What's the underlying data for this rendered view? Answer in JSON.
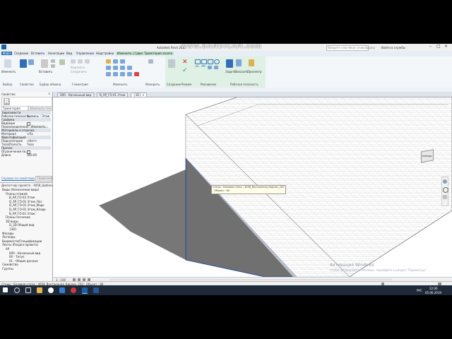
{
  "app": {
    "title": "Autodesk Revit 2019",
    "recorder_watermark": "www.BANDICAM.com",
    "search_placeholder": "Введите ключевое слово/фразу",
    "signin": "Войти в службы"
  },
  "menu": {
    "tabs": [
      "Файл",
      "Создание",
      "Вставить",
      "Аннотации",
      "Вид",
      "Управление",
      "Надстройки",
      "Изменить | Сдвиг",
      "Траектория эскиза"
    ]
  },
  "ribbon": {
    "panels": [
      "Выбор",
      "Свойства",
      "Буфер обмена",
      "Геометрия",
      "Изменить",
      "Измерить",
      "Создание",
      "Режим",
      "Рисование",
      "Рабочая плоскость"
    ],
    "buttons": {
      "modify": "Изменить",
      "paste": "Вставить",
      "set": "Задать",
      "show": "Показать",
      "viewer": "Просмотр"
    }
  },
  "properties": {
    "header": "Свойства",
    "type_selector": "Траектория",
    "edit_type": "Изменить тип",
    "rows": [
      {
        "label": "Зависимости",
        "value": "",
        "section": true
      },
      {
        "label": "Рабочая плоскость",
        "value": "Уровень : Этаж 01",
        "section": false
      },
      {
        "label": "Графика",
        "value": "",
        "section": true
      },
      {
        "label": "Видимые",
        "value": "",
        "section": false
      },
      {
        "label": "Переопределение...",
        "value": "Изменить...",
        "section": false
      },
      {
        "label": "Материалы и отделка",
        "value": "",
        "section": true
      },
      {
        "label": "Материал",
        "value": "<По категории>",
        "section": false
      },
      {
        "label": "Идентификация",
        "value": "",
        "section": true
      },
      {
        "label": "Подкатегория",
        "value": "<Нет>",
        "section": false
      },
      {
        "label": "Тело/Полость",
        "value": "Тело",
        "section": false
      },
      {
        "label": "Прочие",
        "value": "",
        "section": true
      },
      {
        "label": "Ограничения по...",
        "value": "",
        "section": false
      },
      {
        "label": "Длина",
        "value": "360.00",
        "section": false
      }
    ],
    "help_link": "Справка по свойствам",
    "apply_button": "Применить"
  },
  "browser": {
    "header": "Диспетчер проекта - 4058_Шаблон...",
    "items": [
      {
        "indent": 0,
        "label": "Виды (Назначение вида)"
      },
      {
        "indent": 1,
        "label": "Планы этажей"
      },
      {
        "indent": 2,
        "label": "B_AP_ГО-02 Этаж"
      },
      {
        "indent": 2,
        "label": "D_AP_ГО-01 Этаж_Поз"
      },
      {
        "indent": 2,
        "label": "D_AP_ГО-01 Этаж_Марк"
      },
      {
        "indent": 2,
        "label": "D_AP_ГО-01 Этаж_Кладк"
      },
      {
        "indent": 2,
        "label": "B_AP_ГО-01 Этаж"
      },
      {
        "indent": 1,
        "label": "Планы потолков"
      },
      {
        "indent": 1,
        "label": "3D виды"
      },
      {
        "indent": 2,
        "label": "D_3D Общий вид"
      },
      {
        "indent": 2,
        "label": "{3D}"
      },
      {
        "indent": 0,
        "label": "Фасады"
      },
      {
        "indent": 0,
        "label": "Легенды"
      },
      {
        "indent": 0,
        "label": "Ведомости/Спецификации"
      },
      {
        "indent": 0,
        "label": "Листы (Раздел проекта)"
      },
      {
        "indent": 1,
        "label": "АР"
      },
      {
        "indent": 2,
        "label": "000 - Начальный вид"
      },
      {
        "indent": 2,
        "label": "00 - Титул"
      },
      {
        "indent": 2,
        "label": "01 - Общие данные"
      },
      {
        "indent": 0,
        "label": "Семейства"
      },
      {
        "indent": 0,
        "label": "Группы"
      }
    ]
  },
  "view_tabs": [
    {
      "label": "000 - Начальный вид",
      "active": false
    },
    {
      "label": "B_AP_ГО-01 Этаж",
      "active": false
    },
    {
      "label": "{3D}",
      "active": true
    }
  ],
  "tooltip": {
    "line1": "Стены : Базовая стена : 4058_Внутренняя_Кирпич_250",
    "line2": "- Объект : 80"
  },
  "viewcube": {
    "label": "СПЕРЕДИ"
  },
  "viewcontrol": {
    "scale": "1 : 100"
  },
  "status": {
    "text": "Стены : Базовая стена : 4058_Внутренняя_Кирпич_250 : Объект : 80"
  },
  "activation": {
    "line1": "Активация Windows",
    "line2": "Чтобы активировать Windows, перейдите в раздел \"Параметры\"."
  },
  "taskbar": {
    "time": "22:00",
    "date": "05.06.2019",
    "lang": "РУС"
  },
  "colors": {
    "ribbon_bg": "#f4f7fa",
    "context_tab": "#dff0e4",
    "accent_blue": "#2f6fb8",
    "taskbar": "#1f2a38"
  }
}
